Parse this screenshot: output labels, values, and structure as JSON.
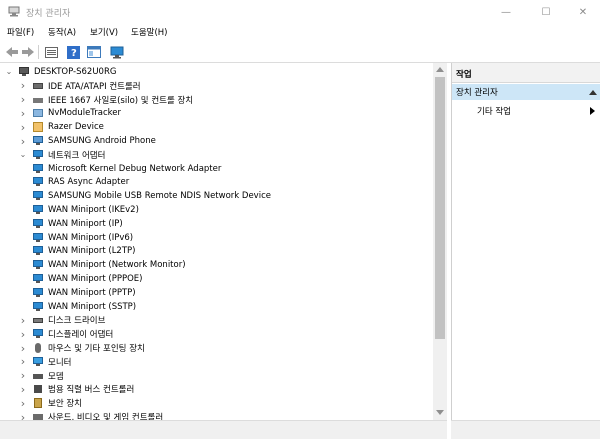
{
  "window": {
    "title": "장치 관리자"
  },
  "menu": [
    "파일(F)",
    "동작(A)",
    "보기(V)",
    "도움말(H)"
  ],
  "toolbar": [
    "back-icon",
    "forward-icon",
    "properties-icon",
    "help-icon",
    "view-icon",
    "monitor-icon"
  ],
  "tree": {
    "root": "DESKTOP-S62U0RG",
    "rows": [
      {
        "label": "IDE ATA/ATAPI 컨트롤러",
        "icon": "ide-controller-icon",
        "expander": "collapsed",
        "level": 1
      },
      {
        "label": "IEEE 1667 사일로(silo) 및 컨트롤 장치",
        "icon": "silo-icon",
        "expander": "collapsed",
        "level": 1
      },
      {
        "label": "NvModuleTracker",
        "icon": "device-icon",
        "expander": "collapsed",
        "level": 1
      },
      {
        "label": "Razer Device",
        "icon": "razer-icon",
        "expander": "collapsed",
        "level": 1
      },
      {
        "label": "SAMSUNG Android Phone",
        "icon": "phone-icon",
        "expander": "collapsed",
        "level": 1
      },
      {
        "label": "네트워크 어댑터",
        "icon": "network-icon",
        "expander": "expanded",
        "level": 1
      },
      {
        "label": "Microsoft Kernel Debug Network Adapter",
        "icon": "network-adapter-icon",
        "level": 2
      },
      {
        "label": "RAS Async Adapter",
        "icon": "network-adapter-icon",
        "level": 2
      },
      {
        "label": "SAMSUNG Mobile USB Remote NDIS Network Device",
        "icon": "network-adapter-icon",
        "level": 2
      },
      {
        "label": "WAN Miniport (IKEv2)",
        "icon": "network-adapter-icon",
        "level": 2
      },
      {
        "label": "WAN Miniport (IP)",
        "icon": "network-adapter-icon",
        "level": 2
      },
      {
        "label": "WAN Miniport (IPv6)",
        "icon": "network-adapter-icon",
        "level": 2
      },
      {
        "label": "WAN Miniport (L2TP)",
        "icon": "network-adapter-icon",
        "level": 2
      },
      {
        "label": "WAN Miniport (Network Monitor)",
        "icon": "network-adapter-icon",
        "level": 2
      },
      {
        "label": "WAN Miniport (PPPOE)",
        "icon": "network-adapter-icon",
        "level": 2
      },
      {
        "label": "WAN Miniport (PPTP)",
        "icon": "network-adapter-icon",
        "level": 2
      },
      {
        "label": "WAN Miniport (SSTP)",
        "icon": "network-adapter-icon",
        "level": 2
      },
      {
        "label": "디스크 드라이브",
        "icon": "disk-icon",
        "expander": "collapsed",
        "level": 1
      },
      {
        "label": "디스플레이 어댑터",
        "icon": "display-icon",
        "expander": "collapsed",
        "level": 1
      },
      {
        "label": "마우스 및 기타 포인팅 장치",
        "icon": "mouse-icon",
        "expander": "collapsed",
        "level": 1
      },
      {
        "label": "모니터",
        "icon": "monitor-icon",
        "expander": "collapsed",
        "level": 1
      },
      {
        "label": "모뎀",
        "icon": "modem-icon",
        "expander": "collapsed",
        "level": 1
      },
      {
        "label": "범용 직렬 버스 컨트롤러",
        "icon": "usb-icon",
        "expander": "collapsed",
        "level": 1
      },
      {
        "label": "보안 장치",
        "icon": "security-icon",
        "expander": "collapsed",
        "level": 1
      },
      {
        "label": "사운드, 비디오 및 게임 컨트롤러",
        "icon": "sound-icon",
        "expander": "collapsed",
        "level": 1
      }
    ]
  },
  "actions": {
    "header": "작업",
    "section": "장치 관리자",
    "item": "기타 작업"
  },
  "colors": {
    "selection": "#cde6f7",
    "accent": "#2c8bd3"
  }
}
